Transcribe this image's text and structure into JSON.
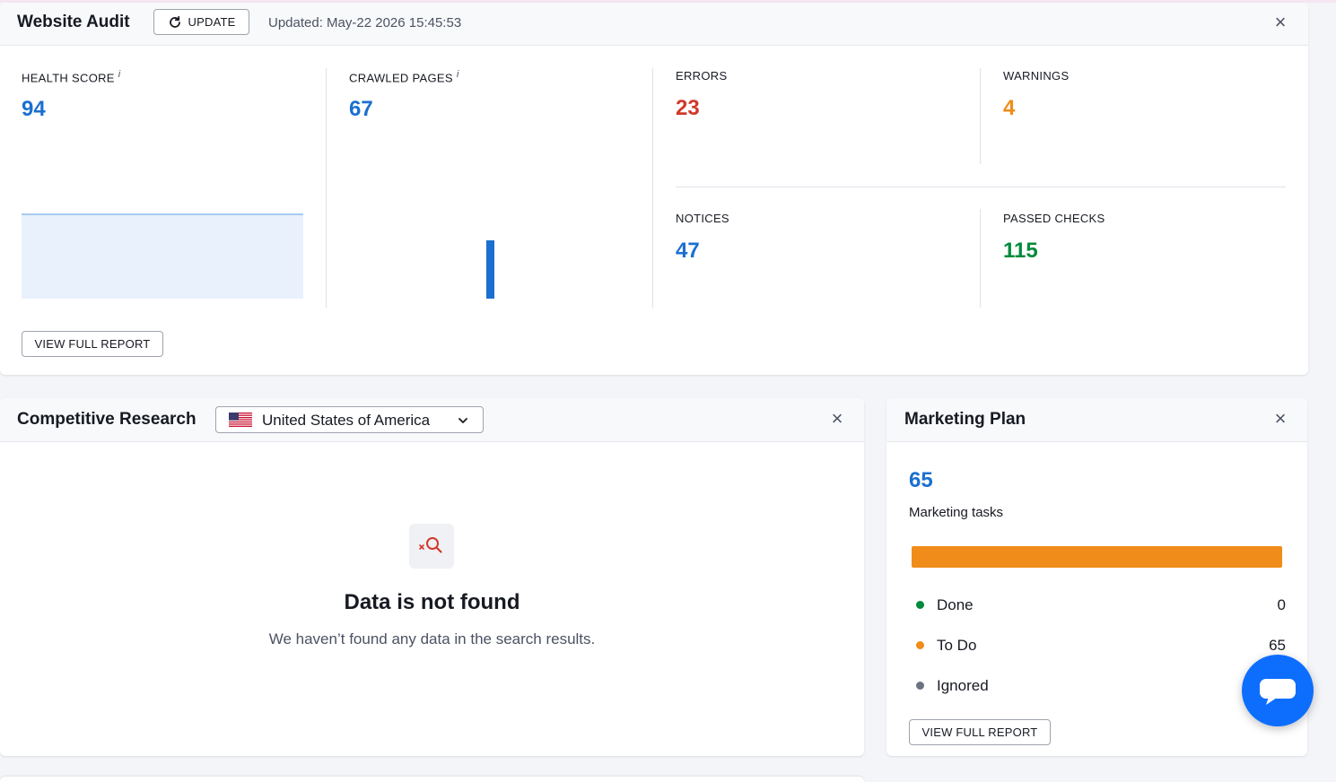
{
  "website_audit": {
    "title": "Website Audit",
    "update_label": "UPDATE",
    "updated_text": "Updated: May-22 2026 15:45:53",
    "health_score": {
      "label": "HEALTH SCORE",
      "info": "i",
      "value": "94"
    },
    "crawled_pages": {
      "label": "CRAWLED PAGES",
      "info": "i",
      "value": "67"
    },
    "errors": {
      "label": "ERRORS",
      "value": "23"
    },
    "warnings": {
      "label": "WARNINGS",
      "value": "4"
    },
    "notices": {
      "label": "NOTICES",
      "value": "47"
    },
    "passed_checks": {
      "label": "PASSED CHECKS",
      "value": "115"
    },
    "view_report_label": "VIEW FULL REPORT"
  },
  "competitive_research": {
    "title": "Competitive Research",
    "country": "United States of America",
    "empty_title": "Data is not found",
    "empty_text": "We haven’t found any data in the search results."
  },
  "marketing_plan": {
    "title": "Marketing Plan",
    "total": "65",
    "total_label": "Marketing tasks",
    "progress_color": "#f08c19",
    "items": [
      {
        "label": "Done",
        "value": "0",
        "color": "#008a3c"
      },
      {
        "label": "To Do",
        "value": "65",
        "color": "#f08c19"
      },
      {
        "label": "Ignored",
        "value": "",
        "color": "#6c7280"
      }
    ],
    "view_report_label": "VIEW FULL REPORT"
  },
  "icons": {
    "close": "close-icon",
    "refresh": "refresh-icon",
    "flag": "us-flag-icon",
    "chevron": "chevron-down-icon",
    "not_found": "search-not-found-icon",
    "chat": "chat-icon"
  },
  "colors": {
    "accent_blue": "#1b6fd0",
    "error_red": "#d1392a",
    "warning_orange": "#f08c19",
    "passed_green": "#008a3c",
    "chat_button": "#0d6efd"
  }
}
